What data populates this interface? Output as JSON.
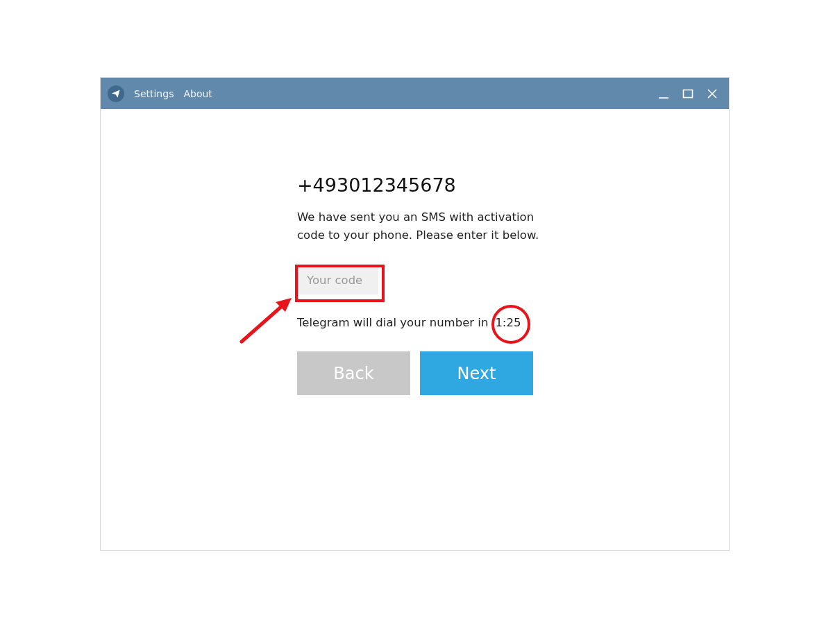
{
  "titlebar": {
    "menu": [
      "Settings",
      "About"
    ]
  },
  "phone": "+493012345678",
  "message": "We have sent you an SMS with activation code to your phone. Please enter it below.",
  "code_field": {
    "placeholder": "Your code"
  },
  "dial_notice": {
    "text": "Telegram will dial your number in",
    "countdown": "1:25"
  },
  "buttons": [
    {
      "label": "Back",
      "kind": "secondary"
    },
    {
      "label": "Next",
      "kind": "primary"
    }
  ]
}
